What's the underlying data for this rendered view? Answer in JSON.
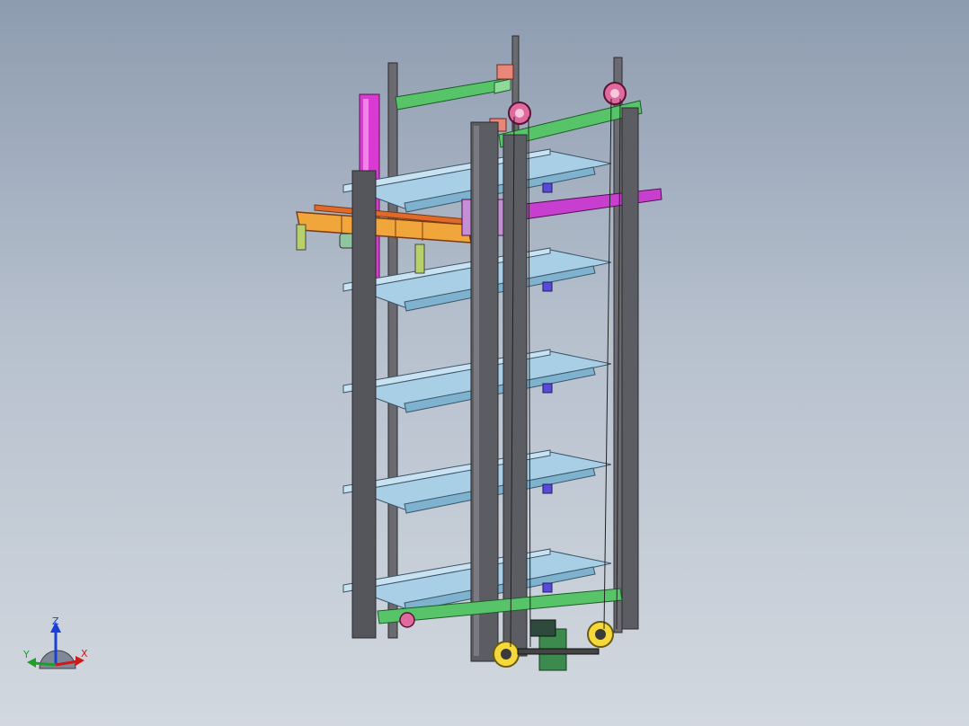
{
  "viewport": {
    "background_top": "#8e9cb0",
    "background_bottom": "#d2d8df"
  },
  "model": {
    "colors": {
      "column": "#5c5c63",
      "column_edge": "#2a2a2e",
      "shelf": "#a9cfe6",
      "shelf_edge": "#3b5566",
      "top_beam": "#57c46a",
      "crossbeam": "#c83fd0",
      "magenta_post": "#d93bd2",
      "lift_frame": "#f0a63a",
      "lift_frame_edge": "#7a3b16",
      "carriage_block": "#c58fd6",
      "pulley": "#e06aa0",
      "drive_yellow": "#f5d83a",
      "motor_green": "#3c8a4e",
      "salmon_block": "#e9867a"
    }
  },
  "triad": {
    "z_label": "Z",
    "y_label": "Y",
    "x_label": "X",
    "z_color": "#1a3fd6",
    "y_color": "#1ea02a",
    "x_color": "#d01a1a"
  }
}
